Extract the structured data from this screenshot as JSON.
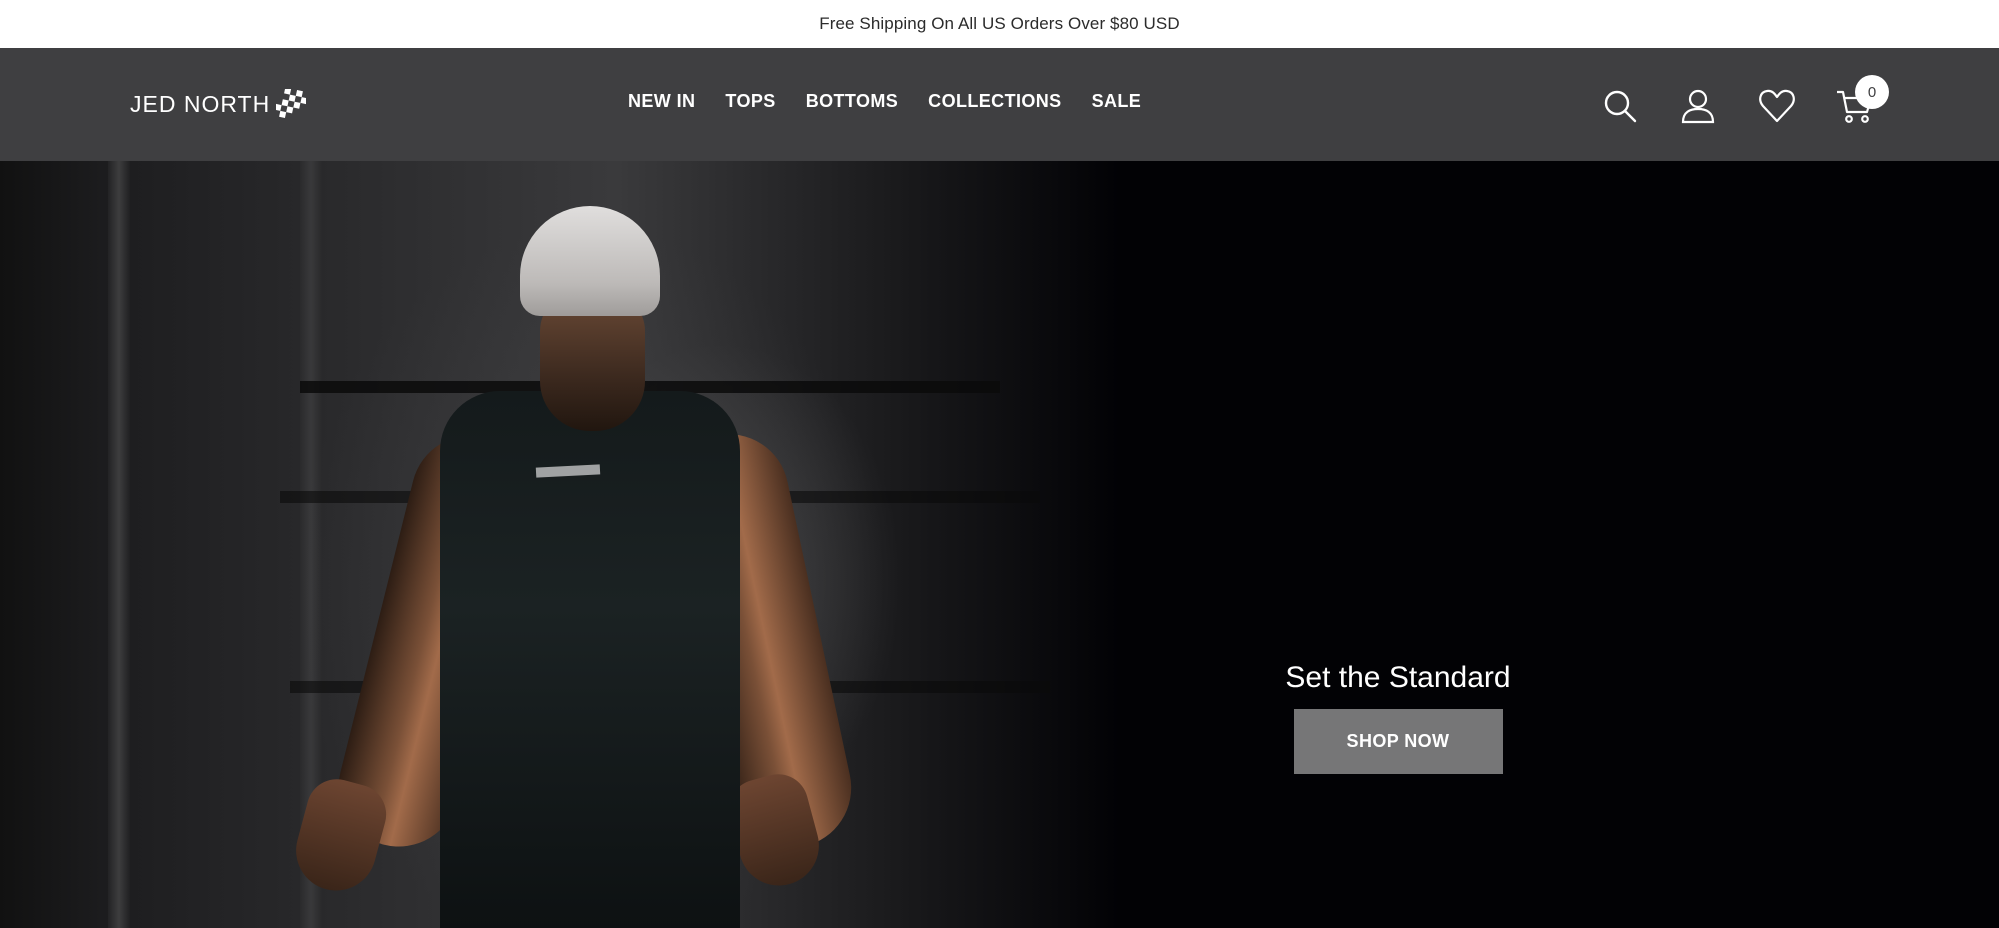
{
  "announcement": {
    "text": "Free Shipping On All US Orders Over $80 USD"
  },
  "header": {
    "logo_text": "JED NORTH",
    "nav": [
      {
        "label": "NEW IN"
      },
      {
        "label": "TOPS"
      },
      {
        "label": "BOTTOMS"
      },
      {
        "label": "COLLECTIONS"
      },
      {
        "label": "SALE"
      }
    ],
    "icons": [
      "search-icon",
      "account-icon",
      "wishlist-heart-icon",
      "cart-icon"
    ],
    "cart_count": "0"
  },
  "hero": {
    "title": "Set the Standard",
    "cta_label": "SHOP NOW"
  },
  "colors": {
    "header_bg": "#3f3f41",
    "announcement_bg": "#ffffff",
    "hero_bg": "#020205",
    "cta_bg": "#767677"
  }
}
